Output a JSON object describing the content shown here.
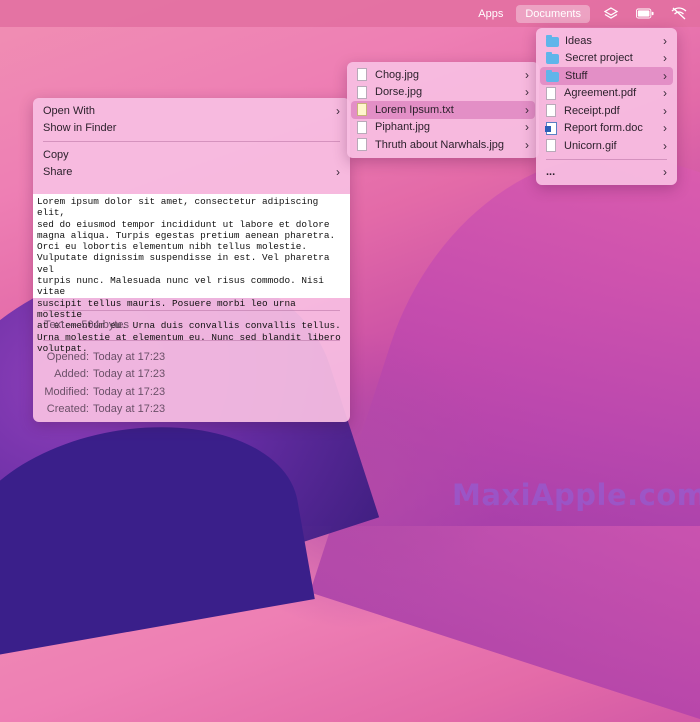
{
  "menubar": {
    "apps": "Apps",
    "documents": "Documents",
    "icons": [
      "layers-icon",
      "battery-icon",
      "wifi-off-icon"
    ]
  },
  "context_menu": {
    "open_with": "Open With",
    "show_in_finder": "Show in Finder",
    "copy": "Copy",
    "share": "Share",
    "preview_text": "Lorem ipsum dolor sit amet, consectetur adipiscing elit,\nsed do eiusmod tempor incididunt ut labore et dolore\nmagna aliqua. Turpis egestas pretium aenean pharetra.\nOrci eu lobortis elementum nibh tellus molestie.\nVulputate dignissim suspendisse in est. Vel pharetra vel\nturpis nunc. Malesuada nunc vel risus commodo. Nisi vitae\nsuscipit tellus mauris. Posuere morbi leo urna molestie\nat elementum eu. Urna duis convallis convallis tellus.\nUrna molestie at elementum eu. Nunc sed blandit libero\nvolutpat.",
    "kind": "Text",
    "size": "504 bytes",
    "meta": [
      {
        "key": "Opened:",
        "value": "Today at 17:23"
      },
      {
        "key": "Added:",
        "value": "Today at 17:23"
      },
      {
        "key": "Modified:",
        "value": "Today at 17:23"
      },
      {
        "key": "Created:",
        "value": "Today at 17:23"
      }
    ]
  },
  "stuff_menu": {
    "items": [
      {
        "label": "Chog.jpg",
        "icon": "image-file-icon"
      },
      {
        "label": "Dorse.jpg",
        "icon": "image-file-icon"
      },
      {
        "label": "Lorem Ipsum.txt",
        "icon": "text-file-icon"
      },
      {
        "label": "Piphant.jpg",
        "icon": "image-file-icon"
      },
      {
        "label": "Thruth about Narwhals.jpg",
        "icon": "image-file-icon"
      }
    ]
  },
  "documents_menu": {
    "items": [
      {
        "label": "Ideas",
        "icon": "folder-icon"
      },
      {
        "label": "Secret project",
        "icon": "folder-icon"
      },
      {
        "label": "Stuff",
        "icon": "folder-icon"
      },
      {
        "label": "Agreement.pdf",
        "icon": "pdf-file-icon"
      },
      {
        "label": "Receipt.pdf",
        "icon": "pdf-file-icon"
      },
      {
        "label": "Report form.doc",
        "icon": "word-file-icon"
      },
      {
        "label": "Unicorn.gif",
        "icon": "image-file-icon"
      }
    ],
    "more": "..."
  },
  "watermark": "MaxiApple.com",
  "colors": {
    "accent": "#5fb5ea",
    "highlight": "#dc82be"
  }
}
